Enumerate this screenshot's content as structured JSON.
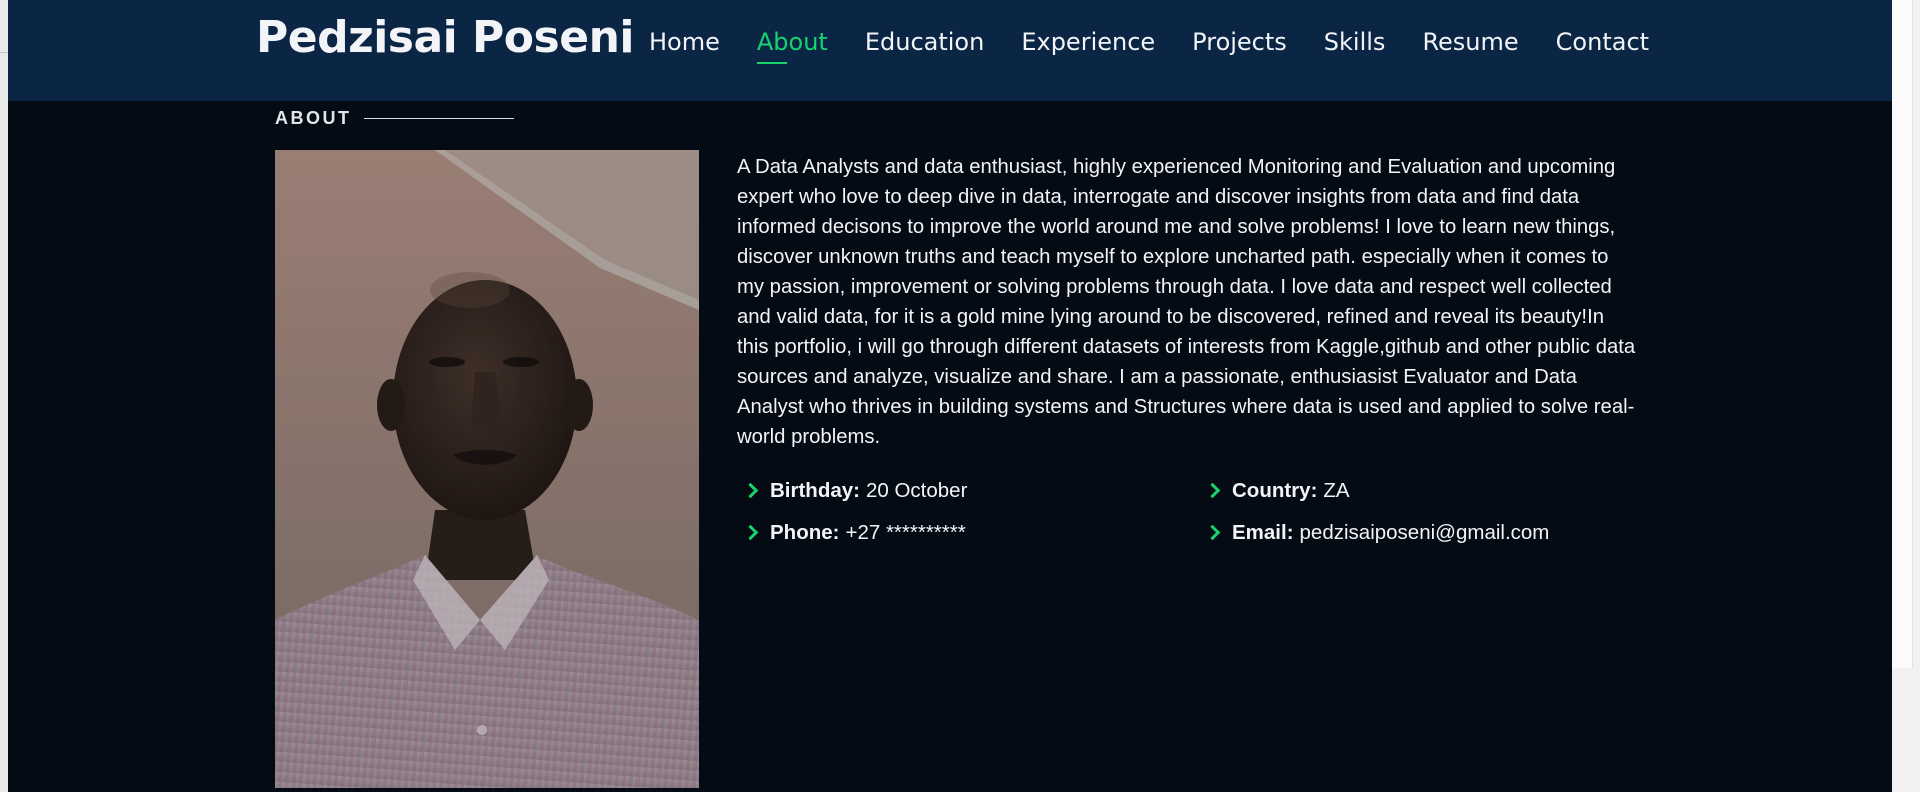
{
  "header": {
    "brand": "Pedzisai Poseni",
    "nav": [
      {
        "label": "Home",
        "active": false
      },
      {
        "label": "About",
        "active": true
      },
      {
        "label": "Education",
        "active": false
      },
      {
        "label": "Experience",
        "active": false
      },
      {
        "label": "Projects",
        "active": false
      },
      {
        "label": "Skills",
        "active": false
      },
      {
        "label": "Resume",
        "active": false
      },
      {
        "label": "Contact",
        "active": false
      }
    ]
  },
  "about": {
    "section_title": "ABOUT",
    "photo_icon": "profile-photo",
    "paragraph": "A Data Analysts and data enthusiast, highly experienced Monitoring and Evaluation and upcoming expert who love to deep dive in data, interrogate and discover insights from data and find data informed decisons to improve the world around me and solve problems! I love to learn new things, discover unknown truths and teach myself to explore uncharted path. especially when it comes to my passion, improvement or solving problems through data. I love data and respect well collected and valid data, for it is a gold mine lying around to be discovered, refined and reveal its beauty!In this portfolio, i will go through different datasets of interests from Kaggle,github and other public data sources and analyze, visualize and share. I am a passionate, enthusiasist Evaluator and Data Analyst who thrives in building systems and Structures where data is used and applied to solve real-world problems.",
    "info_left": [
      {
        "label": "Birthday:",
        "value": "20 October"
      },
      {
        "label": "Phone:",
        "value": "+27 **********"
      }
    ],
    "info_right": [
      {
        "label": "Country:",
        "value": "ZA"
      },
      {
        "label": "Email:",
        "value": "pedzisaiposeni@gmail.com"
      }
    ]
  },
  "colors": {
    "accent": "#18d26e",
    "header_bg": "#0b2545",
    "page_bg": "#040b14",
    "text": "#f2f4f7"
  },
  "icons": {
    "bullet": "chevron-right-icon"
  }
}
